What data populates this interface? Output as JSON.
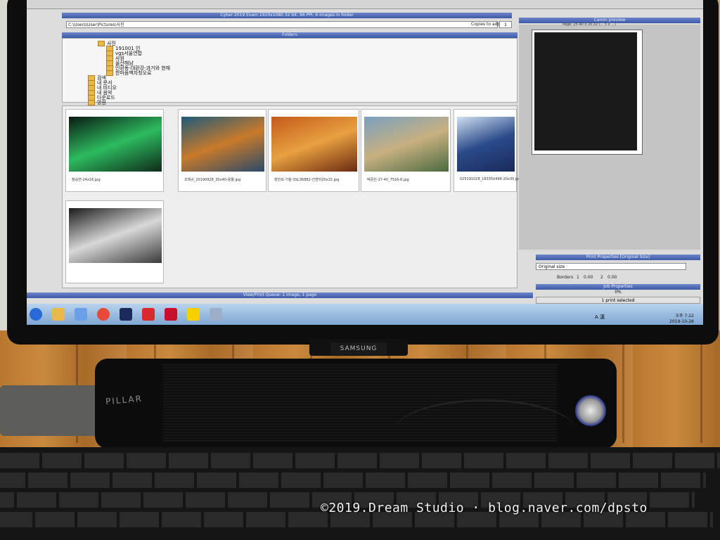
{
  "app": {
    "info_title": "Cyber 2019 Exam 1920x1080 32 bit. 96 PPI, 6 images in folder",
    "preview_title": "Canon preview",
    "preview_size": "Page: 25.40 x 20.32 (... 5 x ...)",
    "path": "C:\\Users\\User\\Pictures\\사진",
    "copies_label": "Copies to add",
    "copies_value": "1",
    "folders_title": "Folders",
    "queue_title": "View/Print Queue: 1 image, 1 page",
    "print_properties_title": "Print Properties [Original Size]",
    "print_size_value": "Original size",
    "borders_label": "Borders",
    "border_values": [
      "1",
      "0.00",
      "2",
      "0.00"
    ],
    "job_properties_title": "Job Properties",
    "job_count": "0%",
    "print_selected_label": "1 print selected"
  },
  "folder_tree": [
    "사진",
    "191001 인",
    "vgs서울연합",
    "사원",
    "울산해남",
    "인환동-대환강-과거와 현재",
    "한마음백자칭오로",
    "검색",
    "내 문서",
    "내 비디오",
    "내 음악",
    "다운로드",
    "망원"
  ],
  "thumbnails": [
    {
      "caption": "정승연-24x16.jpg",
      "colors": [
        "#0a1a12",
        "#2dbb5f",
        "#0f2a1a"
      ]
    },
    {
      "caption": "조태규_20190928_30x40-몽돌.jpg",
      "colors": [
        "#1e5a7a",
        "#c97a2a",
        "#2a4a6a"
      ]
    },
    {
      "caption": "장한모-가을-SSL36882-간변미20x15.jpg",
      "colors": [
        "#c45a1a",
        "#e8a040",
        "#6a2a10"
      ]
    },
    {
      "caption": "박준민-17-40_7516-6.jpg",
      "colors": [
        "#7aa0c0",
        "#c8b080",
        "#4a6a40"
      ]
    },
    {
      "caption": "025191028_183350496-20x30.jpg",
      "colors": [
        "#cfe0f0",
        "#2a4a8a",
        "#1a2a5a"
      ]
    },
    {
      "caption": "",
      "colors": [
        "#1a1a1a",
        "#d8d8d8",
        "#3a3a3a"
      ]
    }
  ],
  "taskbar": {
    "apps": [
      "windows-start",
      "explorer",
      "chat",
      "chrome",
      "photoshop",
      "acrobat",
      "creative-cloud",
      "kakaotalk",
      "notepad"
    ],
    "tray_label": "A 漢",
    "time": "오후 7:22",
    "date": "2019-10-28"
  },
  "monitor_brand": "SAMSUNG",
  "speaker_brand": "PILLAR",
  "watermark": "©2019.Dream Studio · blog.naver.com/dpsto"
}
